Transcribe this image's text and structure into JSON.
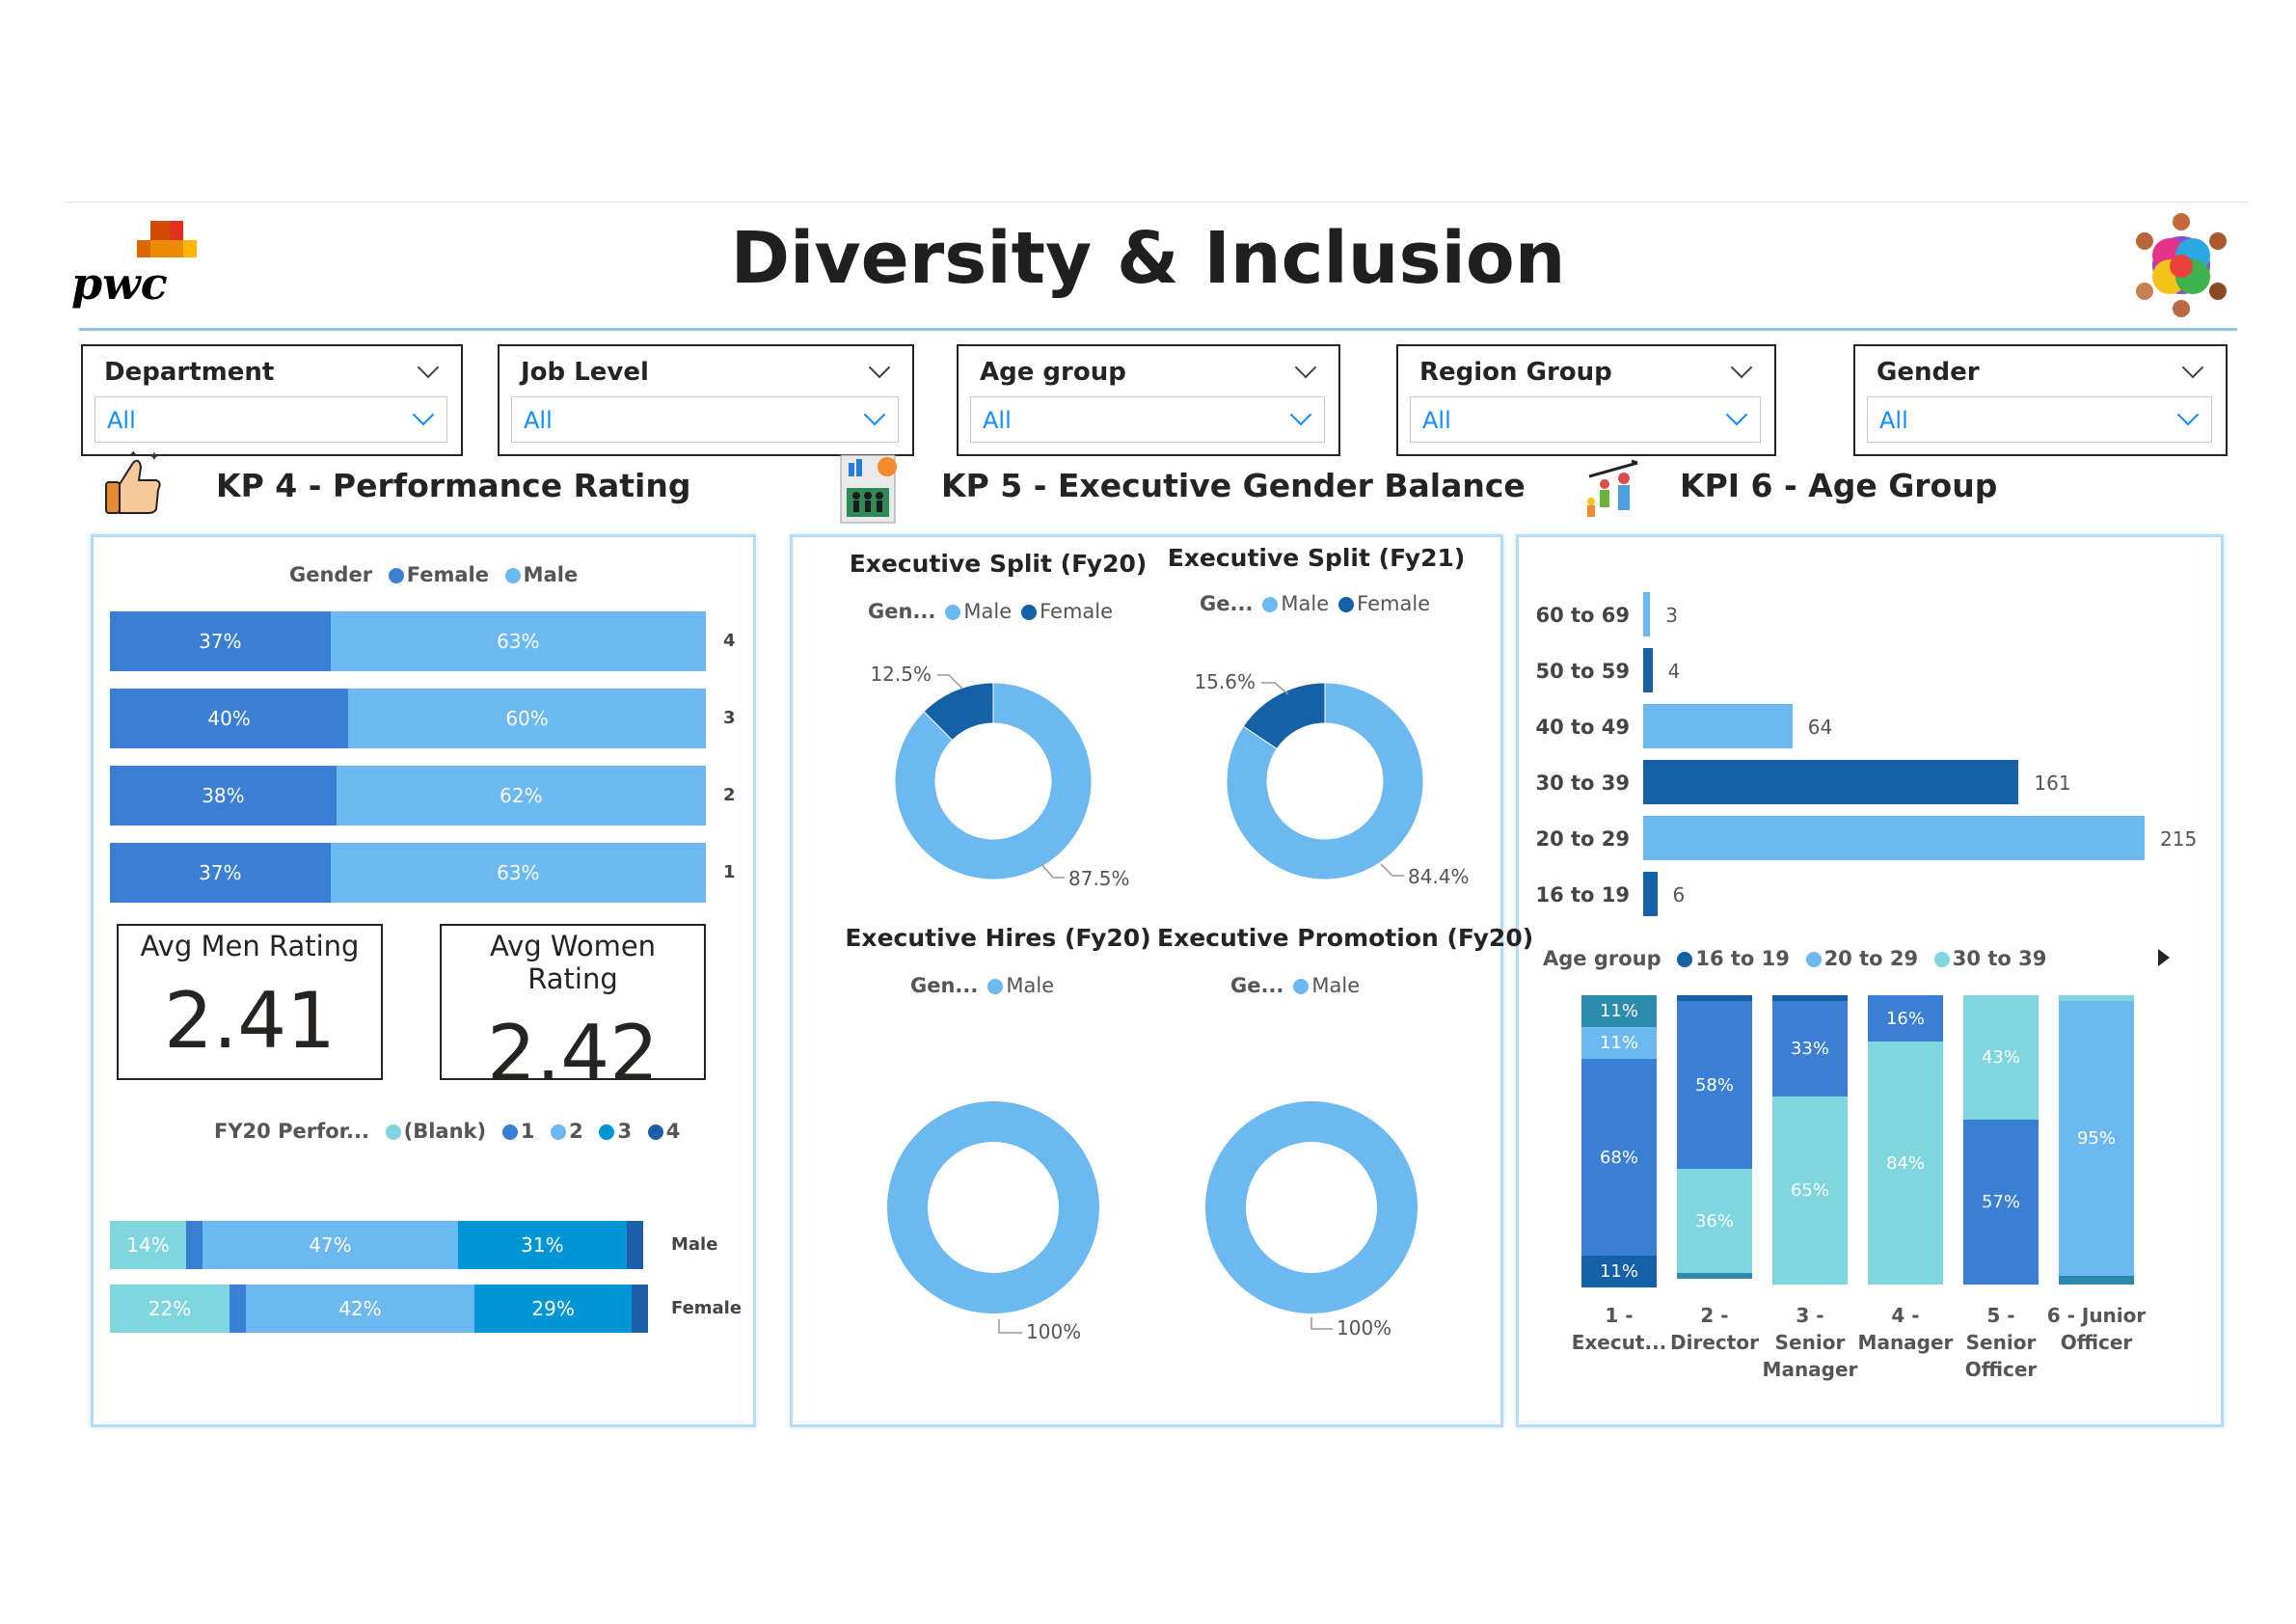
{
  "header": {
    "title": "Diversity & Inclusion",
    "logo_text": "pwc",
    "logo_icon": "pwc-logo",
    "right_icon": "diversity-people-icon"
  },
  "slicers": [
    {
      "title": "Department",
      "value": "All"
    },
    {
      "title": "Job Level",
      "value": "All"
    },
    {
      "title": "Age group",
      "value": "All"
    },
    {
      "title": "Region Group",
      "value": "All"
    },
    {
      "title": "Gender",
      "value": "All"
    }
  ],
  "sections": {
    "kp4": {
      "title": "KP 4 - Performance Rating",
      "icon": "thumbs-up-icon"
    },
    "kp5": {
      "title": "KP 5 - Executive Gender Balance",
      "icon": "executive-report-icon"
    },
    "kpi6": {
      "title": "KPI 6 - Age Group",
      "icon": "age-group-icon"
    }
  },
  "colors": {
    "female": "#3a7fd4",
    "male": "#6cb8f0",
    "dark": "#1660a8",
    "teal": "#7fd6df",
    "blue3": "#0096d6",
    "dark4": "#1c5ea8",
    "light": "#a3c8f5"
  },
  "kp4": {
    "gender_legend": {
      "title": "Gender",
      "items": [
        "Female",
        "Male"
      ]
    },
    "avg_men": {
      "label": "Avg Men Rating",
      "value": "2.41"
    },
    "avg_women": {
      "label": "Avg Women Rating",
      "value": "2.42"
    },
    "perf_legend": {
      "title": "FY20 Perfor...",
      "items": [
        "(Blank)",
        "1",
        "2",
        "3",
        "4"
      ]
    }
  },
  "kp5": {
    "legend_split": {
      "title": "Gen...",
      "items": [
        "Male",
        "Female"
      ]
    },
    "legend_split21": {
      "title": "Ge...",
      "items": [
        "Male",
        "Female"
      ]
    },
    "legend_hires": {
      "title": "Gen...",
      "items": [
        "Male"
      ]
    },
    "legend_promo": {
      "title": "Ge...",
      "items": [
        "Male"
      ]
    }
  },
  "kpi6": {
    "age_legend": {
      "title": "Age group",
      "items": [
        "16 to 19",
        "20 to 29",
        "30 to 39"
      ]
    }
  },
  "chart_data": [
    {
      "id": "perf-rating-gender",
      "type": "bar",
      "orientation": "horizontal-stacked-100",
      "categories": [
        "4",
        "3",
        "2",
        "1"
      ],
      "series": [
        {
          "name": "Female",
          "values": [
            37,
            40,
            38,
            37
          ],
          "labels": [
            "37%",
            "40%",
            "38%",
            "37%"
          ]
        },
        {
          "name": "Male",
          "values": [
            63,
            60,
            62,
            63
          ],
          "labels": [
            "63%",
            "60%",
            "62%",
            "63%"
          ]
        }
      ]
    },
    {
      "id": "perf-rating-fy20",
      "type": "bar",
      "orientation": "horizontal-stacked-100",
      "categories": [
        "Male",
        "Female"
      ],
      "series": [
        {
          "name": "(Blank)",
          "values": [
            14,
            22
          ],
          "labels": [
            "14%",
            "22%"
          ]
        },
        {
          "name": "1",
          "values": [
            3,
            3
          ],
          "labels": [
            "",
            ""
          ]
        },
        {
          "name": "2",
          "values": [
            47,
            42
          ],
          "labels": [
            "47%",
            "42%"
          ]
        },
        {
          "name": "3",
          "values": [
            31,
            29
          ],
          "labels": [
            "31%",
            "29%"
          ]
        },
        {
          "name": "4",
          "values": [
            3,
            3
          ],
          "labels": [
            "",
            ""
          ]
        }
      ]
    },
    {
      "id": "exec-split-fy20",
      "type": "pie",
      "title": "Executive Split (Fy20)",
      "categories": [
        "Male",
        "Female"
      ],
      "values": [
        87.5,
        12.5
      ],
      "labels": [
        "87.5%",
        "12.5%"
      ]
    },
    {
      "id": "exec-split-fy21",
      "type": "pie",
      "title": "Executive Split (Fy21)",
      "categories": [
        "Male",
        "Female"
      ],
      "values": [
        84.4,
        15.6
      ],
      "labels": [
        "84.4%",
        "15.6%"
      ]
    },
    {
      "id": "exec-hires-fy20",
      "type": "pie",
      "title": "Executive Hires (Fy20)",
      "categories": [
        "Male"
      ],
      "values": [
        100
      ],
      "labels": [
        "100%"
      ]
    },
    {
      "id": "exec-promo-fy20",
      "type": "pie",
      "title": "Executive Promotion (Fy20)",
      "categories": [
        "Male"
      ],
      "values": [
        100
      ],
      "labels": [
        "100%"
      ]
    },
    {
      "id": "age-group-count",
      "type": "bar",
      "orientation": "horizontal",
      "categories": [
        "60 to 69",
        "50 to 59",
        "40 to 49",
        "30 to 39",
        "20 to 29",
        "16 to 19"
      ],
      "values": [
        3,
        4,
        64,
        161,
        215,
        6
      ],
      "xlim": [
        0,
        215
      ]
    },
    {
      "id": "age-by-job-level",
      "type": "bar",
      "orientation": "vertical-stacked-100",
      "categories": [
        "1 - Execut...",
        "2 - Director",
        "3 - Senior Manager",
        "4 - Manager",
        "5 - Senior Officer",
        "6 - Junior Officer"
      ],
      "series": [
        {
          "name": "16 to 19",
          "values": [
            11,
            2,
            2,
            0,
            0,
            0
          ]
        },
        {
          "name": "20 to 29",
          "values": [
            11,
            0,
            0,
            0,
            0,
            95
          ]
        },
        {
          "name": "30 to 39",
          "values": [
            0,
            36,
            65,
            84,
            43,
            2
          ]
        },
        {
          "name": "40 to 49",
          "values": [
            68,
            58,
            33,
            16,
            57,
            0
          ]
        },
        {
          "name": "50 to 59",
          "values": [
            11,
            2,
            0,
            0,
            0,
            3
          ]
        }
      ],
      "labels": [
        [
          "11%",
          "11%",
          "",
          "68%",
          "11%"
        ],
        [
          "",
          "",
          "36%",
          "58%",
          ""
        ],
        [
          "",
          "",
          "65%",
          "33%",
          ""
        ],
        [
          "",
          "",
          "84%",
          "16%",
          ""
        ],
        [
          "",
          "",
          "43%",
          "57%",
          ""
        ],
        [
          "",
          "95%",
          "",
          "",
          ""
        ]
      ]
    }
  ]
}
